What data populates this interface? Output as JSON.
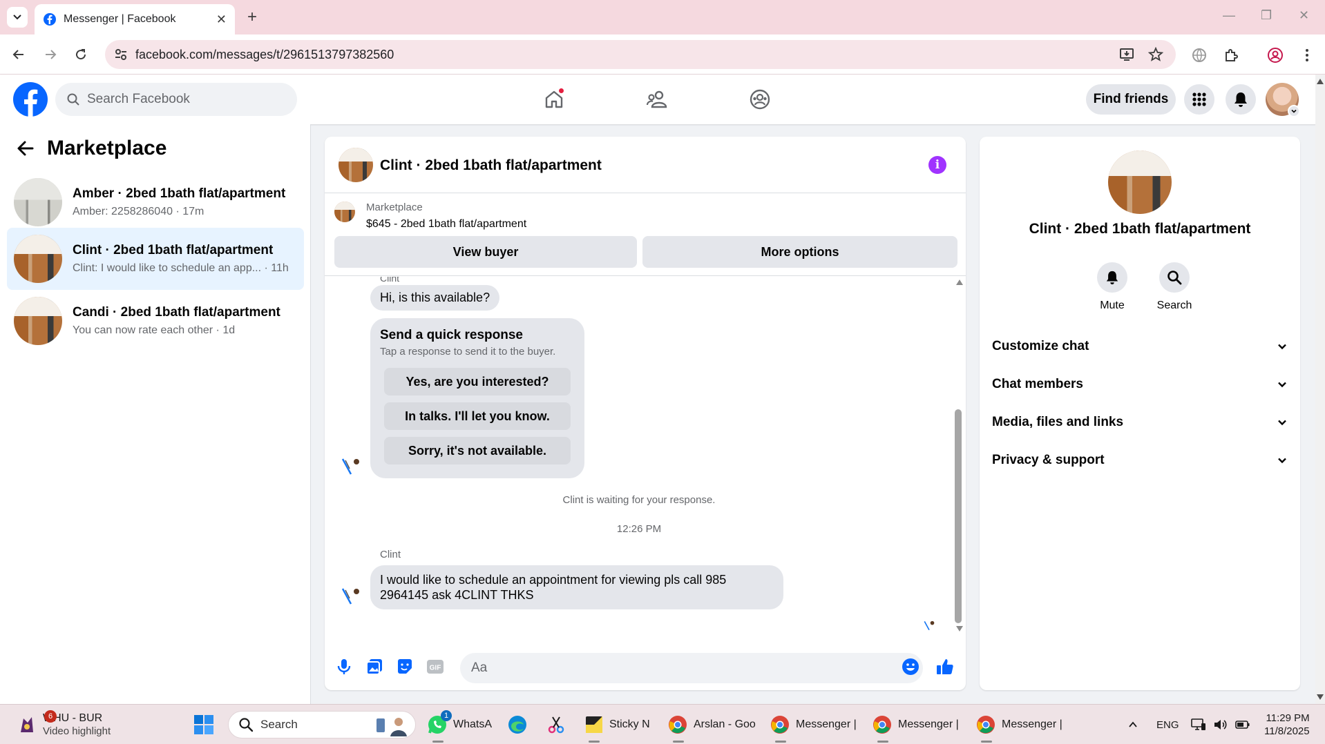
{
  "browser": {
    "tab_title": "Messenger | Facebook",
    "url": "facebook.com/messages/t/2961513797382560"
  },
  "fb": {
    "search_placeholder": "Search Facebook",
    "find_friends": "Find friends",
    "brand_color": "#0866ff"
  },
  "sidebar": {
    "title": "Marketplace",
    "conversations": [
      {
        "name": "Amber · 2bed 1bath flat/apartment",
        "sub": "Amber: 2258286040 · 17m",
        "active": false
      },
      {
        "name": "Clint · 2bed 1bath flat/apartment",
        "sub": "Clint: I would like to schedule an app... · 11h",
        "active": true
      },
      {
        "name": "Candi · 2bed 1bath flat/apartment",
        "sub": "You can now rate each other · 1d",
        "active": false
      }
    ]
  },
  "chat": {
    "title": "Clint · 2bed 1bath flat/apartment",
    "marketplace_label": "Marketplace",
    "listing": "$645 - 2bed 1bath flat/apartment",
    "view_buyer": "View buyer",
    "more_options": "More options",
    "sender_top": "Clint",
    "msg1": "Hi, is this available?",
    "quick_title": "Send a quick response",
    "quick_sub": "Tap a response to send it to the buyer.",
    "quick_options": [
      "Yes, are you interested?",
      "In talks. I'll let you know.",
      "Sorry, it's not available."
    ],
    "waiting": "Clint is waiting for your response.",
    "time": "12:26 PM",
    "sender2": "Clint",
    "msg2": "I would like to schedule an appointment for viewing pls call 985 2964145 ask 4CLINT THKS",
    "composer_placeholder": "Aa"
  },
  "panel": {
    "name": "Clint · 2bed 1bath flat/apartment",
    "mute": "Mute",
    "search": "Search",
    "rows": [
      "Customize chat",
      "Chat members",
      "Media, files and links",
      "Privacy & support"
    ]
  },
  "taskbar": {
    "weather_title": "WHU - BUR",
    "weather_sub": "Video highlight",
    "weather_badge": "6",
    "search": "Search",
    "whatsapp": "WhatsA",
    "whatsapp_badge": "1",
    "sticky": "Sticky N",
    "chrome1": "Arslan - Goo",
    "chrome2": "Messenger |",
    "chrome3": "Messenger |",
    "chrome4": "Messenger |",
    "lang": "ENG",
    "time": "11:29 PM",
    "date": "11/8/2025"
  }
}
